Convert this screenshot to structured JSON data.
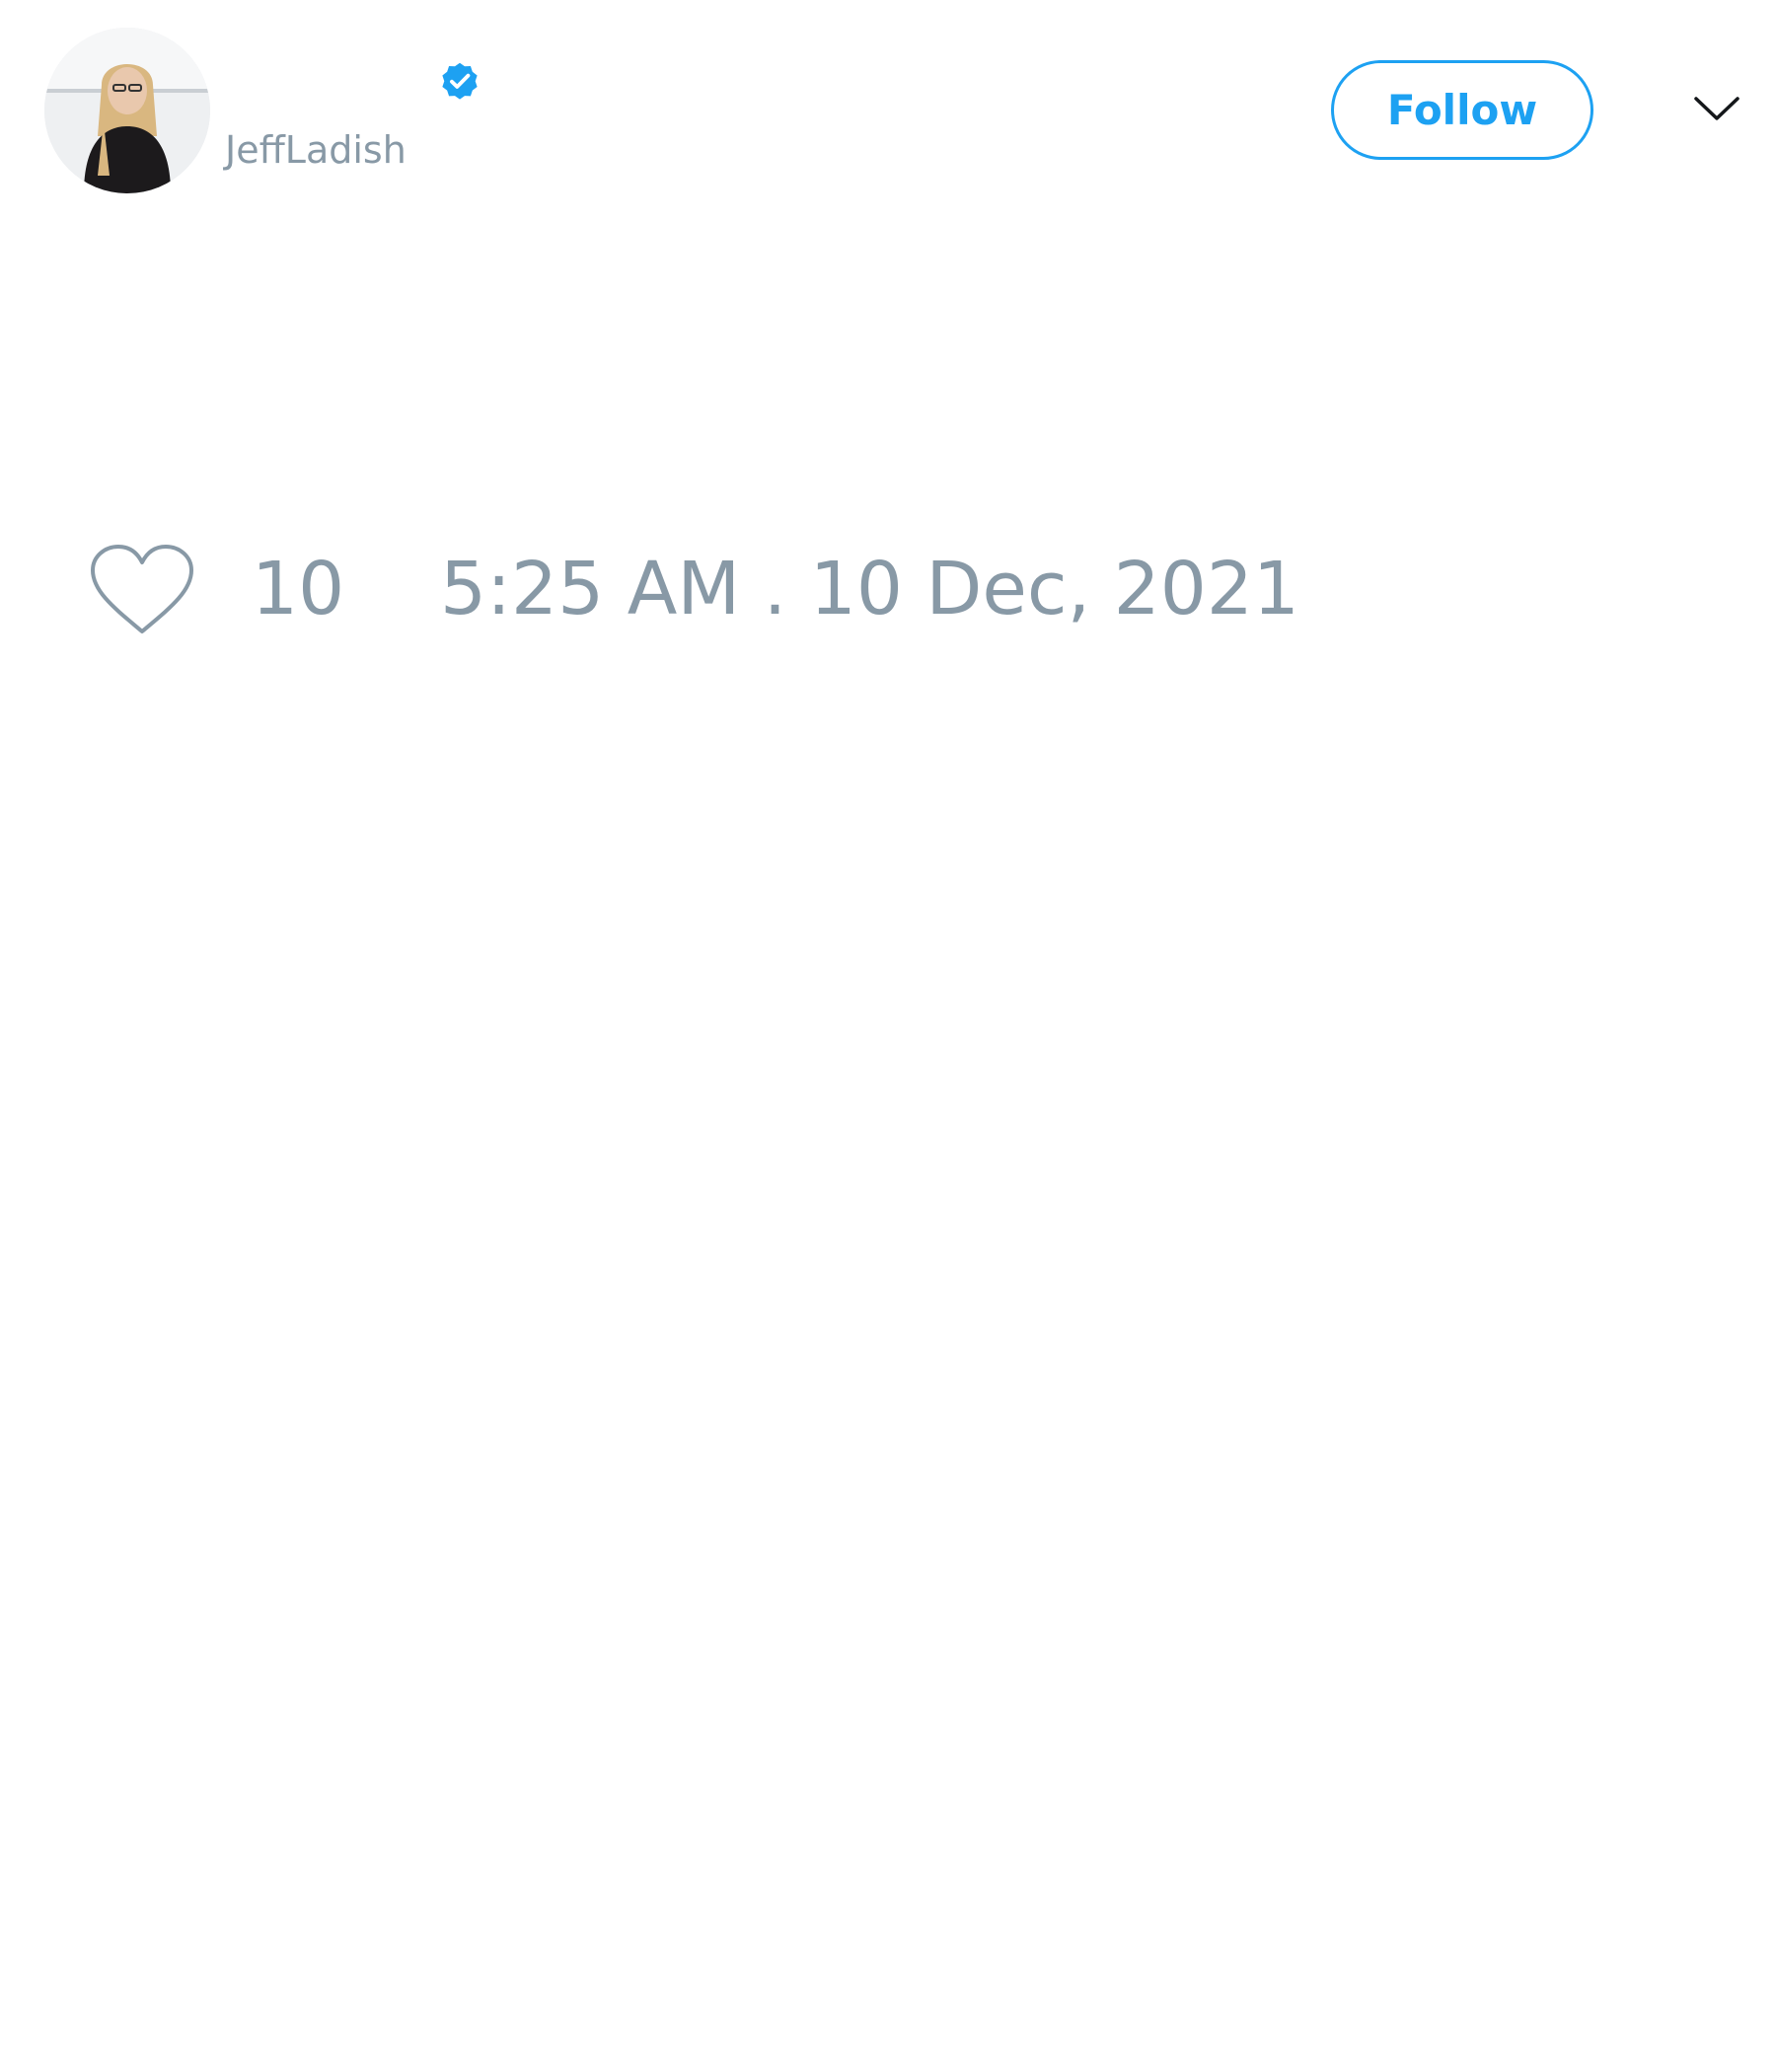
{
  "tweet": {
    "author": {
      "display_name": "",
      "screen_name": "JeffLadish",
      "verified": true,
      "avatar_icon": "avatar-photo"
    },
    "follow_label": "Follow",
    "menu_icon": "chevron-down-icon",
    "like_icon": "heart-outline-icon",
    "like_count": "10",
    "timestamp": "5:25 AM . 10 Dec, 2021"
  },
  "colors": {
    "accent": "#1da1f2",
    "muted_text": "#8899a6",
    "background": "#ffffff"
  }
}
